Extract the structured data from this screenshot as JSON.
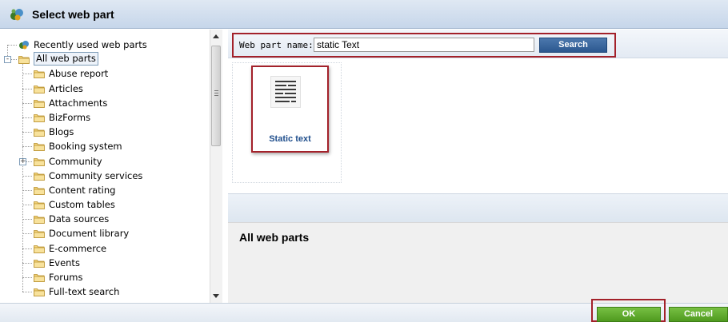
{
  "window": {
    "title": "Select web part",
    "logo_icon": "kentico-logo-icon"
  },
  "tree": {
    "items": [
      {
        "label": "Recently used web parts",
        "icon": "recent-webparts-icon",
        "level": 0,
        "toggle": "",
        "selected": false
      },
      {
        "label": "All web parts",
        "icon": "folder-icon",
        "level": 0,
        "toggle": "-",
        "selected": true
      },
      {
        "label": "Abuse report",
        "icon": "folder-icon",
        "level": 1,
        "toggle": "",
        "selected": false
      },
      {
        "label": "Articles",
        "icon": "folder-icon",
        "level": 1,
        "toggle": "",
        "selected": false
      },
      {
        "label": "Attachments",
        "icon": "folder-icon",
        "level": 1,
        "toggle": "",
        "selected": false
      },
      {
        "label": "BizForms",
        "icon": "folder-icon",
        "level": 1,
        "toggle": "",
        "selected": false
      },
      {
        "label": "Blogs",
        "icon": "folder-icon",
        "level": 1,
        "toggle": "",
        "selected": false
      },
      {
        "label": "Booking system",
        "icon": "folder-icon",
        "level": 1,
        "toggle": "",
        "selected": false
      },
      {
        "label": "Community",
        "icon": "folder-icon",
        "level": 1,
        "toggle": "+",
        "selected": false
      },
      {
        "label": "Community services",
        "icon": "folder-icon",
        "level": 1,
        "toggle": "",
        "selected": false
      },
      {
        "label": "Content rating",
        "icon": "folder-icon",
        "level": 1,
        "toggle": "",
        "selected": false
      },
      {
        "label": "Custom tables",
        "icon": "folder-icon",
        "level": 1,
        "toggle": "",
        "selected": false
      },
      {
        "label": "Data sources",
        "icon": "folder-icon",
        "level": 1,
        "toggle": "",
        "selected": false
      },
      {
        "label": "Document library",
        "icon": "folder-icon",
        "level": 1,
        "toggle": "",
        "selected": false
      },
      {
        "label": "E-commerce",
        "icon": "folder-icon",
        "level": 1,
        "toggle": "",
        "selected": false
      },
      {
        "label": "Events",
        "icon": "folder-icon",
        "level": 1,
        "toggle": "",
        "selected": false
      },
      {
        "label": "Forums",
        "icon": "folder-icon",
        "level": 1,
        "toggle": "",
        "selected": false
      },
      {
        "label": "Full-text search",
        "icon": "folder-icon",
        "level": 1,
        "toggle": "",
        "selected": false
      }
    ]
  },
  "search": {
    "label": "Web part name:",
    "value": "static Text",
    "button_label": "Search"
  },
  "results": [
    {
      "label": "Static text",
      "icon": "static-text-webpart-icon"
    }
  ],
  "description": {
    "title": "All web parts"
  },
  "footer": {
    "ok_label": "OK",
    "cancel_label": "Cancel"
  },
  "colors": {
    "highlight_frame": "#a3212a",
    "primary_button": "#2b578f",
    "confirm_button": "#4f9a1f",
    "tile_label": "#1f4e8c"
  }
}
